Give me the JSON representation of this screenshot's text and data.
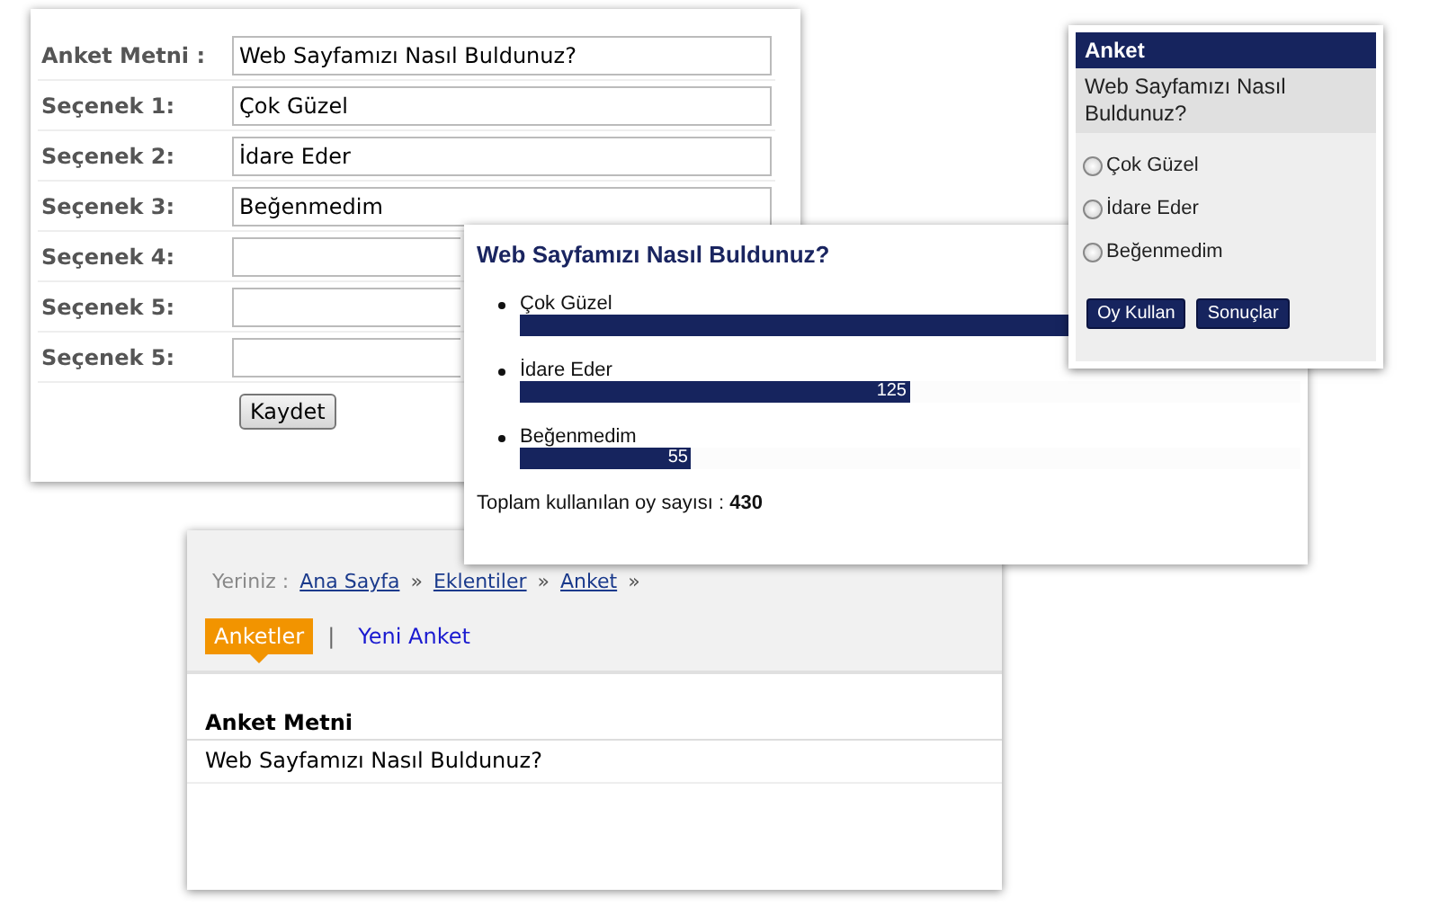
{
  "form": {
    "rows": [
      {
        "label": "Anket Metni :",
        "value": "Web Sayfamızı Nasıl Buldunuz?"
      },
      {
        "label": "Seçenek 1:",
        "value": "Çok Güzel"
      },
      {
        "label": "Seçenek 2:",
        "value": "İdare Eder"
      },
      {
        "label": "Seçenek 3:",
        "value": "Beğenmedim"
      },
      {
        "label": "Seçenek 4:",
        "value": ""
      },
      {
        "label": "Seçenek 5:",
        "value": ""
      },
      {
        "label": "Seçenek 5:",
        "value": ""
      }
    ],
    "save_button": "Kaydet"
  },
  "admin": {
    "breadcrumb_label": "Yeriniz :",
    "breadcrumb": [
      "Ana Sayfa",
      "Eklentiler",
      "Anket"
    ],
    "separator": "»",
    "tabs": [
      {
        "label": "Anketler",
        "selected": true
      },
      {
        "label": "Yeni Anket",
        "selected": false
      }
    ],
    "tab_divider": "|",
    "table": {
      "column": "Anket Metni",
      "rows": [
        "Web Sayfamızı Nasıl Buldunuz?"
      ]
    }
  },
  "results": {
    "title": "Web Sayfamızı Nasıl Buldunuz?",
    "items": [
      {
        "label": "Çok Güzel",
        "level": 1.0
      },
      {
        "label": "İdare Eder",
        "level": 0.5,
        "count": "125"
      },
      {
        "label": "Beğenmedim",
        "level": 0.22,
        "count": "55"
      }
    ],
    "total_label": "Toplam kullanılan oy sayısı :",
    "total": "430"
  },
  "widget": {
    "title": "Anket",
    "question": "Web Sayfamızı Nasıl Buldunuz?",
    "options": [
      {
        "label": "Çok Güzel",
        "selected": false
      },
      {
        "label": "İdare Eder",
        "selected": false
      },
      {
        "label": "Beğenmedim",
        "selected": false
      }
    ],
    "buttons": [
      "Oy Kullan",
      "Sonuçlar"
    ]
  }
}
